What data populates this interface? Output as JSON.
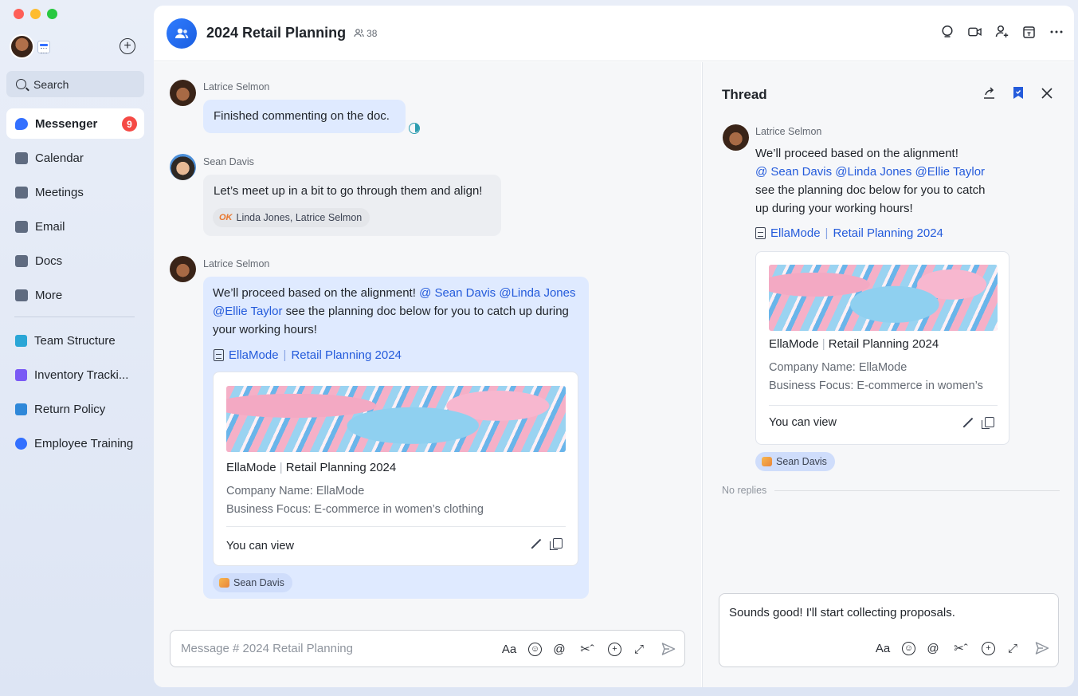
{
  "sidebar": {
    "search_label": "Search",
    "items": [
      {
        "label": "Messenger",
        "badge": "9",
        "icon": "messenger-icon",
        "active": true
      },
      {
        "label": "Calendar",
        "icon": "calendar-icon"
      },
      {
        "label": "Meetings",
        "icon": "video-icon"
      },
      {
        "label": "Email",
        "icon": "mail-icon"
      },
      {
        "label": "Docs",
        "icon": "docs-icon"
      },
      {
        "label": "More",
        "icon": "grid-icon"
      }
    ],
    "shortcuts": [
      {
        "label": "Team Structure",
        "color": "#2aa6d6"
      },
      {
        "label": "Inventory Tracki...",
        "color": "#7a5af5"
      },
      {
        "label": "Return Policy",
        "color": "#2f88d9"
      },
      {
        "label": "Employee Training",
        "color": "#3370ff"
      }
    ]
  },
  "header": {
    "title": "2024 Retail Planning",
    "member_count": "38"
  },
  "messages": [
    {
      "sender": "Latrice Selmon",
      "text": "Finished commenting on the doc."
    },
    {
      "sender": "Sean Davis",
      "text": "Let’s meet up in a bit to go through them and align!",
      "reaction_tag": "OK",
      "reaction_names": "Linda Jones, Latrice Selmon"
    },
    {
      "sender": "Latrice Selmon",
      "text_start": "We’ll proceed based on the alignment! ",
      "mention_1": "@ Sean Davis",
      "mention_2": "@Linda Jones",
      "mention_3": "@Ellie Taylor",
      "text_end": " see the planning doc below for you to catch up during",
      "text_end_2": "your working hours!",
      "doc_brand": "EllaMode",
      "doc_name": "Retail Planning 2024",
      "card_brand": "EllaMode",
      "card_name": "Retail Planning 2024",
      "card_line_1": "Company Name: EllaMode",
      "card_line_2": "Business Focus: E-commerce in women’s clothing",
      "card_permission": "You can view",
      "reaction_names": "Sean Davis"
    }
  ],
  "composer": {
    "placeholder": "Message # 2024 Retail Planning",
    "font_label": "Aa"
  },
  "thread": {
    "title": "Thread",
    "sender": "Latrice Selmon",
    "line_1": "We’ll proceed based on the alignment!",
    "mentions": "@ Sean Davis @Linda Jones @Ellie Taylor",
    "line_2": "see the planning doc below for you to catch",
    "line_3": "up during your working hours!",
    "doc_brand": "EllaMode",
    "doc_name": "Retail Planning 2024",
    "card_brand": "EllaMode",
    "card_name": "Retail Planning 2024",
    "card_line_1": "Company Name: EllaMode",
    "card_line_2": "Business Focus: E-commerce in women’s",
    "card_permission": "You can view",
    "reaction_names": "Sean Davis",
    "no_replies": "No replies",
    "composer_text": "Sounds good! I'll start collecting proposals.",
    "font_label": "Aa"
  },
  "colors": {
    "accent": "#3370ff",
    "badge": "#f54a45",
    "mention": "#245bdb"
  }
}
